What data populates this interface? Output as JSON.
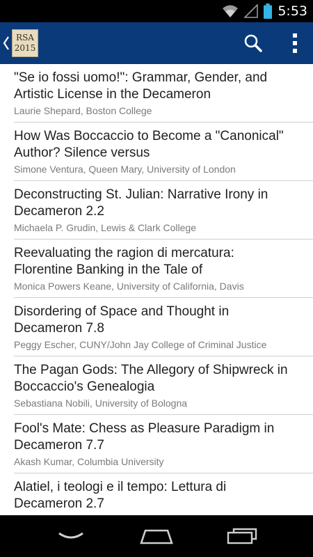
{
  "status_bar": {
    "time": "5:53",
    "icons": [
      "wifi-icon",
      "signal-icon",
      "battery-icon"
    ]
  },
  "action_bar": {
    "logo_line1": "RSA",
    "logo_line2": "2015",
    "icons": [
      "back-caret-icon",
      "search-icon",
      "overflow-menu-icon"
    ],
    "color": "#0a3a7a"
  },
  "papers": [
    {
      "title": "\"Se io fossi uomo!\": Grammar, Gender, and Artistic License in the Decameron",
      "author": "Laurie Shepard, Boston College"
    },
    {
      "title": "How Was Boccaccio to Become a \"Canonical\" Author? Silence versus",
      "author": "Simone Ventura, Queen Mary, University of London"
    },
    {
      "title": "Deconstructing St. Julian: Narrative Irony in Decameron 2.2",
      "author": "Michaela P. Grudin, Lewis & Clark College"
    },
    {
      "title": "Reevaluating the ragion di mercatura: Florentine Banking in the Tale of",
      "author": "Monica Powers Keane, University of California, Davis"
    },
    {
      "title": "Disordering of Space and Thought in Decameron 7.8",
      "author": "Peggy Escher, CUNY/John Jay College of Criminal Justice"
    },
    {
      "title": "The Pagan Gods: The Allegory of Shipwreck in Boccaccio's Genealogia",
      "author": "Sebastiana Nobili, University of Bologna"
    },
    {
      "title": "Fool's Mate: Chess as Pleasure Paradigm in Decameron 7.7",
      "author": "Akash Kumar, Columbia University"
    },
    {
      "title": "Alatiel, i teologi e il tempo: Lettura di Decameron 2.7",
      "author": ""
    }
  ],
  "nav_bar": {
    "icons": [
      "back-icon",
      "home-icon",
      "recent-apps-icon"
    ]
  }
}
